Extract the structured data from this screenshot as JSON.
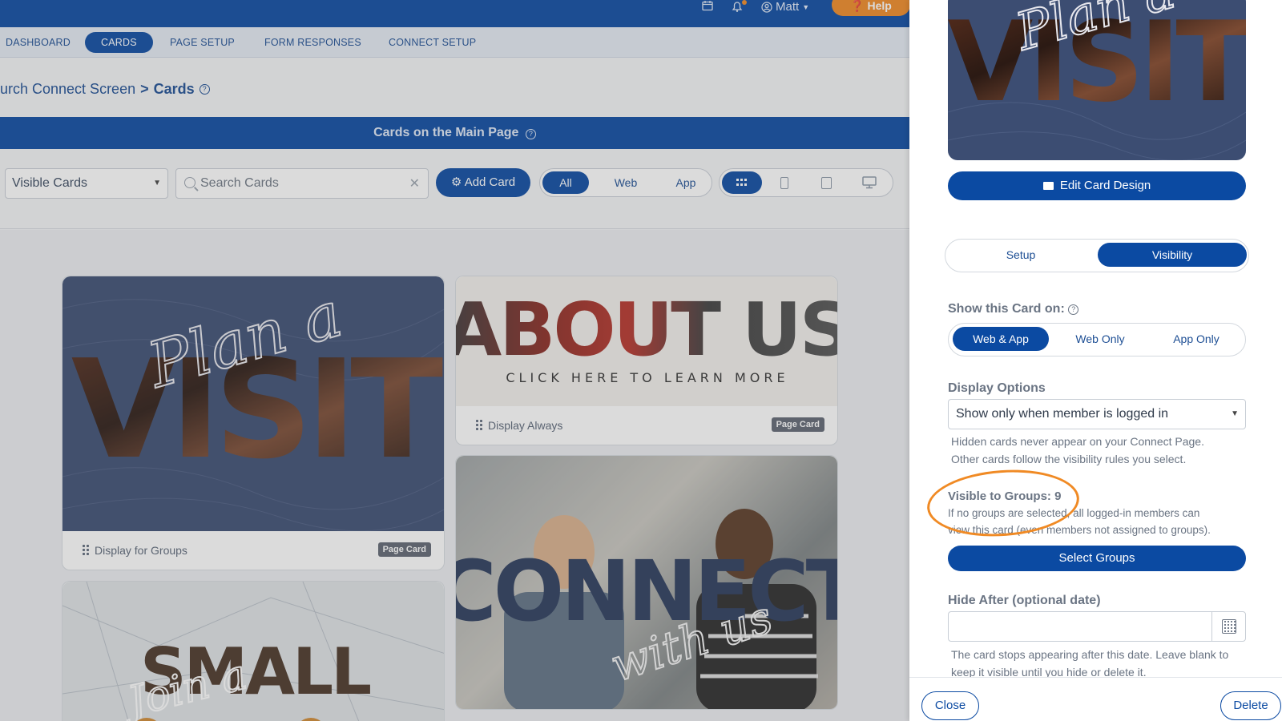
{
  "topbar": {
    "calendar_icon": "calendar-icon",
    "bell_icon": "bell-icon",
    "user_name": "Matt",
    "help_label": "Help"
  },
  "nav": {
    "tabs": [
      {
        "label": "DASHBOARD"
      },
      {
        "label": "CARDS",
        "active": true
      },
      {
        "label": "PAGE SETUP"
      },
      {
        "label": "FORM RESPONSES"
      },
      {
        "label": "CONNECT SETUP"
      }
    ]
  },
  "breadcrumb": {
    "parent": "urch Connect Screen",
    "separator": ">",
    "current": "Cards"
  },
  "section": {
    "title": "Cards on the Main Page"
  },
  "toolbar": {
    "filter_value": "Visible Cards",
    "search_placeholder": "Search Cards",
    "add_card_label": "Add Card",
    "platform_filters": [
      "All",
      "Web",
      "App"
    ],
    "platform_active": "All",
    "device_views": [
      "grid-icon",
      "phone-icon",
      "tablet-icon",
      "desktop-icon"
    ]
  },
  "cards": [
    {
      "title_script": "Plan a",
      "title_block": "VISIT",
      "label": "Display for Groups",
      "badge": "Page Card"
    },
    {
      "title_block": "ABOUT US",
      "subtitle": "CLICK HERE TO LEARN MORE",
      "label": "Display Always",
      "badge": "Page Card"
    },
    {
      "title_block": "CONNECT",
      "title_script": "with us"
    },
    {
      "title_block": "SMALL",
      "title_script": "Join a"
    }
  ],
  "drawer": {
    "preview": {
      "title_script": "Plan a",
      "title_block": "VISIT"
    },
    "edit_design_label": "Edit Card Design",
    "tabs": [
      "Setup",
      "Visibility"
    ],
    "active_tab": "Visibility",
    "show_on": {
      "heading": "Show this Card on:",
      "options": [
        "Web & App",
        "Web Only",
        "App Only"
      ],
      "active": "Web & App"
    },
    "display_options": {
      "heading": "Display Options",
      "value": "Show only when member is logged in",
      "help_line1": "Hidden cards never appear on your Connect Page.",
      "help_line2": "Other cards follow the visibility rules you select."
    },
    "groups": {
      "heading": "Visible to Groups: 9",
      "help_line1": "If no groups are selected, all logged-in members can",
      "help_line2": "view this card (even members not assigned to groups).",
      "button_label": "Select Groups"
    },
    "hide_after": {
      "heading": "Hide After (optional date)",
      "value": "",
      "help_line1": "The card stops appearing after this date. Leave blank to",
      "help_line2": "keep it visible until you hide or delete it."
    },
    "close_label": "Close",
    "delete_label": "Delete"
  },
  "colors": {
    "brand_blue": "#0b4aa2",
    "accent_orange": "#f08a24",
    "card_navy": "#3c4d72"
  }
}
